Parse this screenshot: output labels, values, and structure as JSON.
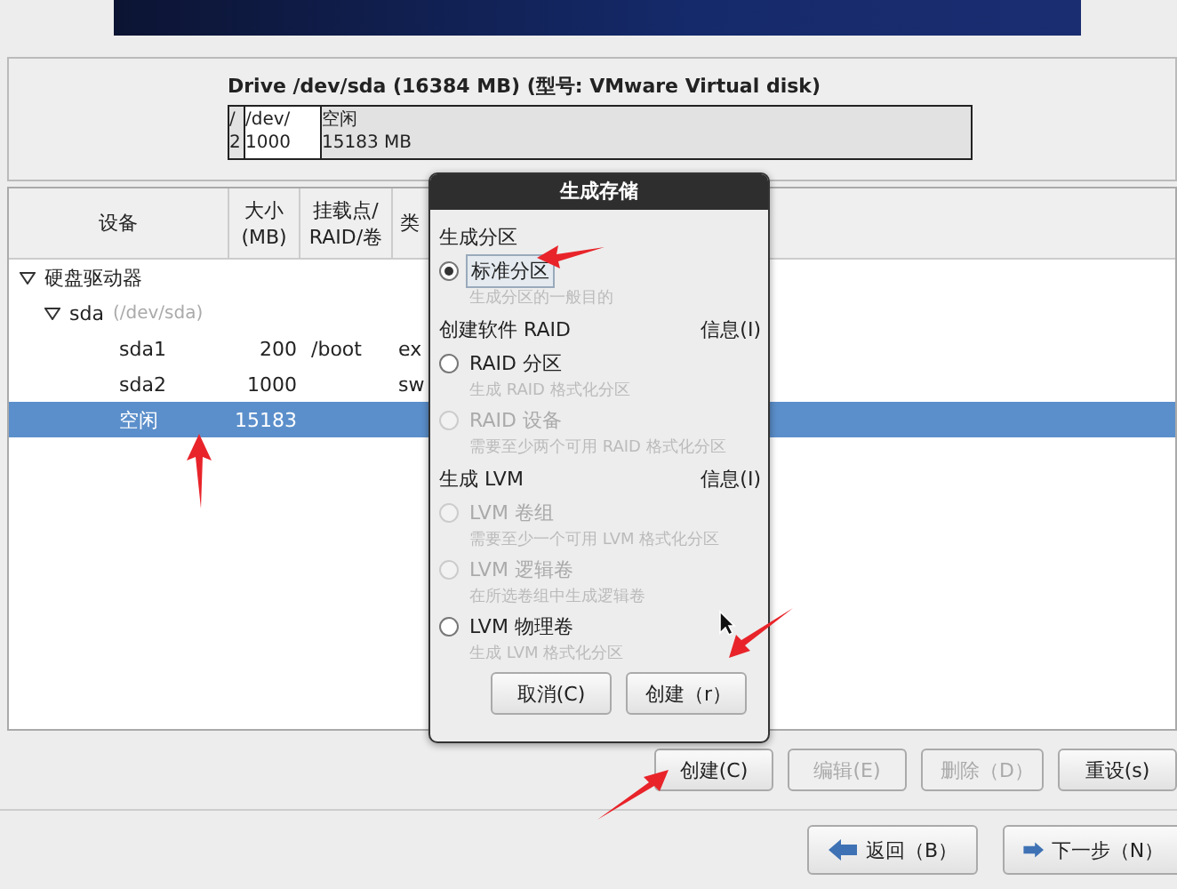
{
  "drive": {
    "title": "Drive /dev/sda (16384 MB) (型号: VMware Virtual disk)",
    "segments": [
      {
        "line_1": "/",
        "line_2": "2",
        "selected": false
      },
      {
        "line_1": "/dev/",
        "line_2": "1000",
        "selected": false
      },
      {
        "line_1": "空闲",
        "line_2": "15183 MB",
        "selected": true
      }
    ]
  },
  "table": {
    "columns": [
      "设备",
      "大小\n(MB)",
      "挂载点/\nRAID/卷",
      "类"
    ],
    "rows": [
      {
        "device": "硬盘驱动器",
        "expanded": true,
        "selected": false,
        "children": [
          {
            "device": "sda",
            "note": "(/dev/sda)",
            "expanded": true,
            "selected": false,
            "children": [
              {
                "device": "sda1",
                "size": "200",
                "mount": "/boot",
                "type": "ex",
                "selected": false
              },
              {
                "device": "sda2",
                "size": "1000",
                "type": "sw",
                "selected": false
              },
              {
                "device": "空闲",
                "size": "15183",
                "selected": true
              }
            ]
          }
        ]
      }
    ]
  },
  "actions": [
    {
      "label": "创建(C)",
      "disabled": false
    },
    {
      "label": "编辑(E)",
      "disabled": true
    },
    {
      "label": "删除（D）",
      "disabled": true
    },
    {
      "label": "重设(s)",
      "disabled": false
    }
  ],
  "navigation": [
    {
      "label": "返回（B）",
      "kind": "back"
    },
    {
      "label": "下一步（N）",
      "kind": "next"
    }
  ],
  "dialog": {
    "title": "生成存储",
    "sections": [
      {
        "title": "生成分区",
        "options": [
          {
            "label": "标准分区",
            "hint": "生成分区的一般目的",
            "selected": true,
            "disabled": false
          }
        ]
      },
      {
        "title": "创建软件 RAID",
        "info": "信息(I)",
        "options": [
          {
            "label": "RAID 分区",
            "hint": "生成 RAID 格式化分区",
            "selected": false,
            "disabled": false
          },
          {
            "label": "RAID 设备",
            "hint": "需要至少两个可用 RAID 格式化分区",
            "selected": false,
            "disabled": true
          }
        ]
      },
      {
        "title": "生成 LVM",
        "info": "信息(I)",
        "options": [
          {
            "label": "LVM 卷组",
            "hint": "需要至少一个可用 LVM 格式化分区",
            "selected": false,
            "disabled": true
          },
          {
            "label": "LVM 逻辑卷",
            "hint": "在所选卷组中生成逻辑卷",
            "selected": false,
            "disabled": true
          },
          {
            "label": "LVM 物理卷",
            "hint": "生成 LVM 格式化分区",
            "selected": false,
            "disabled": false
          }
        ]
      }
    ],
    "buttons": [
      "取消(C)",
      "创建（r）"
    ]
  }
}
